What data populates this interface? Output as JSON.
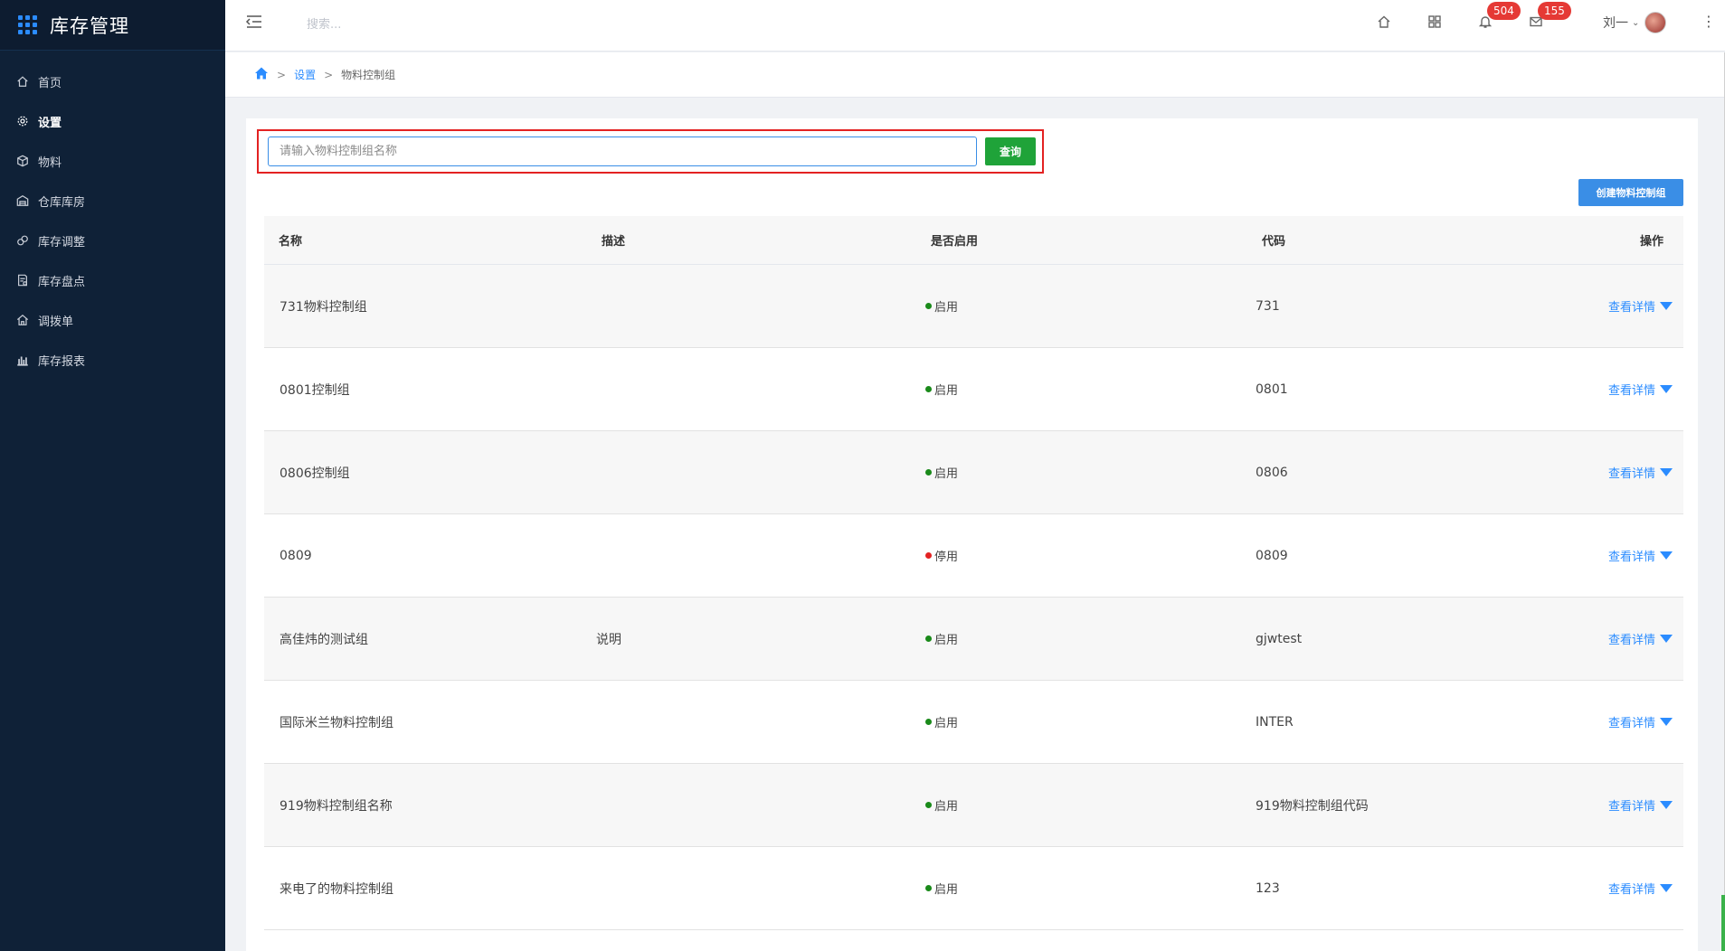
{
  "app": {
    "title": "库存管理"
  },
  "sidebar": {
    "items": [
      {
        "label": "首页",
        "icon": "home-icon",
        "active": false
      },
      {
        "label": "设置",
        "icon": "gear-icon",
        "active": true
      },
      {
        "label": "物料",
        "icon": "cube-icon",
        "active": false
      },
      {
        "label": "仓库库房",
        "icon": "warehouse-icon",
        "active": false
      },
      {
        "label": "库存调整",
        "icon": "adjust-icon",
        "active": false
      },
      {
        "label": "库存盘点",
        "icon": "inventory-icon",
        "active": false
      },
      {
        "label": "调拨单",
        "icon": "transfer-icon",
        "active": false
      },
      {
        "label": "库存报表",
        "icon": "bar-chart-icon",
        "active": false
      }
    ]
  },
  "topbar": {
    "search_placeholder": "搜索...",
    "notifications_count": "504",
    "messages_count": "155",
    "user_name": "刘一"
  },
  "breadcrumb": {
    "level1": "设置",
    "level2": "物料控制组"
  },
  "query": {
    "placeholder": "请输入物料控制组名称",
    "button_label": "查询"
  },
  "create_button": "创建物料控制组",
  "table": {
    "headers": [
      "名称",
      "描述",
      "是否启用",
      "代码",
      "操作"
    ],
    "rows": [
      {
        "name": "731物料控制组",
        "desc": "",
        "status": "启用",
        "code": "731",
        "action": "查看详情"
      },
      {
        "name": "0801控制组",
        "desc": "",
        "status": "启用",
        "code": "0801",
        "action": "查看详情"
      },
      {
        "name": "0806控制组",
        "desc": "",
        "status": "启用",
        "code": "0806",
        "action": "查看详情"
      },
      {
        "name": "0809",
        "desc": "",
        "status": "停用",
        "code": "0809",
        "action": "查看详情"
      },
      {
        "name": "高佳炜的测试组",
        "desc": "说明",
        "status": "启用",
        "code": "gjwtest",
        "action": "查看详情"
      },
      {
        "name": "国际米兰物料控制组",
        "desc": "",
        "status": "启用",
        "code": "INTER",
        "action": "查看详情"
      },
      {
        "name": "919物料控制组名称",
        "desc": "",
        "status": "启用",
        "code": "919物料控制组代码",
        "action": "查看详情"
      },
      {
        "name": "来电了的物料控制组",
        "desc": "",
        "status": "启用",
        "code": "123",
        "action": "查看详情"
      }
    ]
  },
  "colors": {
    "sidebar_bg": "#0f2137",
    "accent": "#2b8cff",
    "enabled": "#1a8a1a",
    "disabled": "#e32222",
    "query_button": "#1fa339",
    "badge": "#e53935"
  }
}
